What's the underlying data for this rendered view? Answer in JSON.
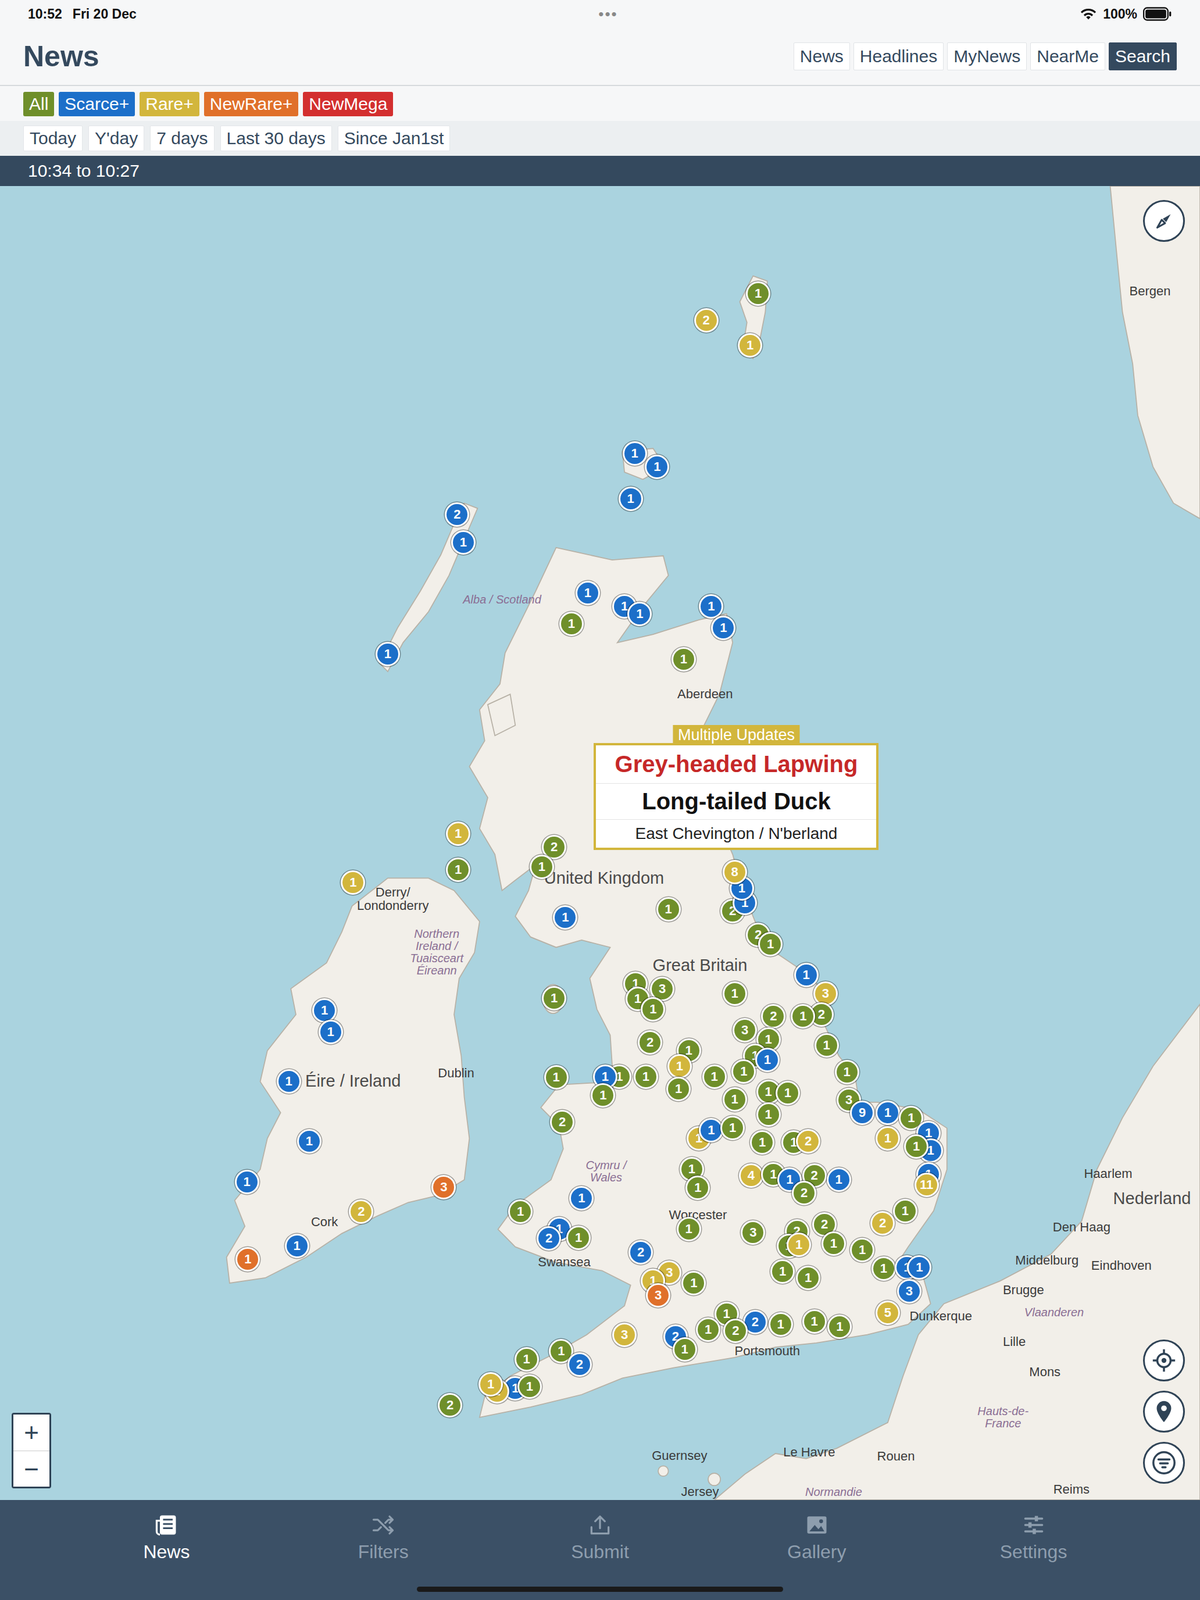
{
  "status_bar": {
    "time": "10:52",
    "date": "Fri 20 Dec",
    "dots": "•••",
    "battery": "100%"
  },
  "header": {
    "title": "News",
    "tabs": [
      {
        "label": "News",
        "selected": false
      },
      {
        "label": "Headlines",
        "selected": false
      },
      {
        "label": "MyNews",
        "selected": false
      },
      {
        "label": "NearMe",
        "selected": false
      },
      {
        "label": "Search",
        "selected": true
      }
    ]
  },
  "filters": [
    {
      "label": "All",
      "color": "#6f8f2a"
    },
    {
      "label": "Scarce+",
      "color": "#1c6fc9"
    },
    {
      "label": "Rare+",
      "color": "#d2b63c"
    },
    {
      "label": "NewRare+",
      "color": "#e0702a"
    },
    {
      "label": "NewMega",
      "color": "#d32f2f"
    }
  ],
  "periods": [
    "Today",
    "Y'day",
    "7 days",
    "Last 30 days",
    "Since Jan1st"
  ],
  "time_range": "10:34 to 10:27",
  "map": {
    "labels": [
      {
        "text": "Bergen",
        "kind": "city"
      },
      {
        "text": "Alba / Scotland",
        "kind": "region"
      },
      {
        "text": "Aberdeen",
        "kind": "city"
      },
      {
        "text": "United Kingdom",
        "kind": "country"
      },
      {
        "text": "Great Britain",
        "kind": "country"
      },
      {
        "text": "Derry/\nLondonderry",
        "kind": "city"
      },
      {
        "text": "Northern\nIreland /\nTuaisceart\nÉireann",
        "kind": "region"
      },
      {
        "text": "Éire / Ireland",
        "kind": "country"
      },
      {
        "text": "Dublin",
        "kind": "city"
      },
      {
        "text": "Cork",
        "kind": "city"
      },
      {
        "text": "Swansea",
        "kind": "city"
      },
      {
        "text": "Cymru /\nWales",
        "kind": "region"
      },
      {
        "text": "Worcester",
        "kind": "city"
      },
      {
        "text": "Portsmouth",
        "kind": "city"
      },
      {
        "text": "Guernsey",
        "kind": "city"
      },
      {
        "text": "Jersey",
        "kind": "city"
      },
      {
        "text": "Le Havre",
        "kind": "city"
      },
      {
        "text": "Rouen",
        "kind": "city"
      },
      {
        "text": "Normandie",
        "kind": "region"
      },
      {
        "text": "Dunkerque",
        "kind": "city"
      },
      {
        "text": "Brugge",
        "kind": "city"
      },
      {
        "text": "Vlaanderen",
        "kind": "region"
      },
      {
        "text": "Middelburg",
        "kind": "city"
      },
      {
        "text": "Den Haag",
        "kind": "city"
      },
      {
        "text": "Haarlem",
        "kind": "city"
      },
      {
        "text": "Nederland",
        "kind": "country"
      },
      {
        "text": "Eindhoven",
        "kind": "city"
      },
      {
        "text": "Lille",
        "kind": "city"
      },
      {
        "text": "Mons",
        "kind": "city"
      },
      {
        "text": "Hauts-de-\nFrance",
        "kind": "region"
      },
      {
        "text": "Reims",
        "kind": "city"
      }
    ],
    "pins": [
      {
        "count": "1",
        "color": "#6f8f2a"
      },
      {
        "count": "2",
        "color": "#d2b63c"
      },
      {
        "count": "1",
        "color": "#d2b63c"
      },
      {
        "count": "1",
        "color": "#1c6fc9"
      },
      {
        "count": "1",
        "color": "#1c6fc9"
      },
      {
        "count": "1",
        "color": "#1c6fc9"
      },
      {
        "count": "2",
        "color": "#1c6fc9"
      },
      {
        "count": "1",
        "color": "#1c6fc9"
      },
      {
        "count": "1",
        "color": "#1c6fc9"
      },
      {
        "count": "1",
        "color": "#1c6fc9"
      },
      {
        "count": "1",
        "color": "#6f8f2a"
      },
      {
        "count": "1",
        "color": "#1c6fc9"
      },
      {
        "count": "1",
        "color": "#1c6fc9"
      },
      {
        "count": "1",
        "color": "#1c6fc9"
      },
      {
        "count": "1",
        "color": "#1c6fc9"
      },
      {
        "count": "1",
        "color": "#6f8f2a"
      },
      {
        "count": "1",
        "color": "#d2b63c"
      },
      {
        "count": "1",
        "color": "#6f8f2a"
      },
      {
        "count": "2",
        "color": "#6f8f2a"
      },
      {
        "count": "1",
        "color": "#6f8f2a"
      },
      {
        "count": "1",
        "color": "#d2b63c"
      },
      {
        "count": "1",
        "color": "#1c6fc9"
      },
      {
        "count": "1",
        "color": "#6f8f2a"
      },
      {
        "count": "2",
        "color": "#6f8f2a"
      },
      {
        "count": "1",
        "color": "#1c6fc9"
      },
      {
        "count": "1",
        "color": "#1c6fc9"
      },
      {
        "count": "8",
        "color": "#d2b63c"
      },
      {
        "count": "2",
        "color": "#6f8f2a"
      },
      {
        "count": "1",
        "color": "#6f8f2a"
      },
      {
        "count": "1",
        "color": "#6f8f2a"
      },
      {
        "count": "1",
        "color": "#6f8f2a"
      },
      {
        "count": "1",
        "color": "#6f8f2a"
      },
      {
        "count": "3",
        "color": "#6f8f2a"
      },
      {
        "count": "1",
        "color": "#6f8f2a"
      },
      {
        "count": "1",
        "color": "#6f8f2a"
      },
      {
        "count": "1",
        "color": "#1c6fc9"
      },
      {
        "count": "3",
        "color": "#d2b63c"
      },
      {
        "count": "2",
        "color": "#6f8f2a"
      },
      {
        "count": "1",
        "color": "#6f8f2a"
      },
      {
        "count": "2",
        "color": "#6f8f2a"
      },
      {
        "count": "3",
        "color": "#6f8f2a"
      },
      {
        "count": "1",
        "color": "#6f8f2a"
      },
      {
        "count": "1",
        "color": "#6f8f2a"
      },
      {
        "count": "2",
        "color": "#6f8f2a"
      },
      {
        "count": "1",
        "color": "#6f8f2a"
      },
      {
        "count": "1",
        "color": "#6f8f2a"
      },
      {
        "count": "1",
        "color": "#6f8f2a"
      },
      {
        "count": "1",
        "color": "#1c6fc9"
      },
      {
        "count": "1",
        "color": "#6f8f2a"
      },
      {
        "count": "1",
        "color": "#6f8f2a"
      },
      {
        "count": "1",
        "color": "#6f8f2a"
      },
      {
        "count": "1",
        "color": "#1c6fc9"
      },
      {
        "count": "1",
        "color": "#d2b63c"
      },
      {
        "count": "1",
        "color": "#6f8f2a"
      },
      {
        "count": "1",
        "color": "#6f8f2a"
      },
      {
        "count": "1",
        "color": "#6f8f2a"
      },
      {
        "count": "1",
        "color": "#6f8f2a"
      },
      {
        "count": "1",
        "color": "#6f8f2a"
      },
      {
        "count": "1",
        "color": "#6f8f2a"
      },
      {
        "count": "1",
        "color": "#6f8f2a"
      },
      {
        "count": "3",
        "color": "#6f8f2a"
      },
      {
        "count": "9",
        "color": "#1c6fc9"
      },
      {
        "count": "1",
        "color": "#1c6fc9"
      },
      {
        "count": "1",
        "color": "#6f8f2a"
      },
      {
        "count": "1",
        "color": "#1c6fc9"
      },
      {
        "count": "1",
        "color": "#1c6fc9"
      },
      {
        "count": "1",
        "color": "#1c6fc9"
      },
      {
        "count": "2",
        "color": "#6f8f2a"
      },
      {
        "count": "1",
        "color": "#d2b63c"
      },
      {
        "count": "1",
        "color": "#1c6fc9"
      },
      {
        "count": "1",
        "color": "#6f8f2a"
      },
      {
        "count": "1",
        "color": "#6f8f2a"
      },
      {
        "count": "1",
        "color": "#6f8f2a"
      },
      {
        "count": "1",
        "color": "#6f8f2a"
      },
      {
        "count": "2",
        "color": "#d2b63c"
      },
      {
        "count": "1",
        "color": "#d2b63c"
      },
      {
        "count": "1",
        "color": "#6f8f2a"
      },
      {
        "count": "1",
        "color": "#6f8f2a"
      },
      {
        "count": "4",
        "color": "#d2b63c"
      },
      {
        "count": "1",
        "color": "#6f8f2a"
      },
      {
        "count": "1",
        "color": "#1c6fc9"
      },
      {
        "count": "2",
        "color": "#6f8f2a"
      },
      {
        "count": "1",
        "color": "#1c6fc9"
      },
      {
        "count": "2",
        "color": "#6f8f2a"
      },
      {
        "count": "1",
        "color": "#6f8f2a"
      },
      {
        "count": "11",
        "color": "#d2b63c"
      },
      {
        "count": "1",
        "color": "#1c6fc9"
      },
      {
        "count": "1",
        "color": "#6f8f2a"
      },
      {
        "count": "3",
        "color": "#6f8f2a"
      },
      {
        "count": "2",
        "color": "#6f8f2a"
      },
      {
        "count": "2",
        "color": "#6f8f2a"
      },
      {
        "count": "1",
        "color": "#6f8f2a"
      },
      {
        "count": "2",
        "color": "#d2b63c"
      },
      {
        "count": "1",
        "color": "#1c6fc9"
      },
      {
        "count": "2",
        "color": "#1c6fc9"
      },
      {
        "count": "1",
        "color": "#6f8f2a"
      },
      {
        "count": "1",
        "color": "#6f8f2a"
      },
      {
        "count": "1",
        "color": "#6f8f2a"
      },
      {
        "count": "1",
        "color": "#d2b63c"
      },
      {
        "count": "1",
        "color": "#6f8f2a"
      },
      {
        "count": "1",
        "color": "#6f8f2a"
      },
      {
        "count": "2",
        "color": "#1c6fc9"
      },
      {
        "count": "3",
        "color": "#d2b63c"
      },
      {
        "count": "1",
        "color": "#d2b63c"
      },
      {
        "count": "1",
        "color": "#6f8f2a"
      },
      {
        "count": "3",
        "color": "#e0702a"
      },
      {
        "count": "1",
        "color": "#6f8f2a"
      },
      {
        "count": "1",
        "color": "#6f8f2a"
      },
      {
        "count": "1",
        "color": "#6f8f2a"
      },
      {
        "count": "1",
        "color": "#1c6fc9"
      },
      {
        "count": "1",
        "color": "#1c6fc9"
      },
      {
        "count": "3",
        "color": "#1c6fc9"
      },
      {
        "count": "5",
        "color": "#d2b63c"
      },
      {
        "count": "1",
        "color": "#6f8f2a"
      },
      {
        "count": "2",
        "color": "#1c6fc9"
      },
      {
        "count": "1",
        "color": "#6f8f2a"
      },
      {
        "count": "1",
        "color": "#6f8f2a"
      },
      {
        "count": "1",
        "color": "#6f8f2a"
      },
      {
        "count": "1",
        "color": "#6f8f2a"
      },
      {
        "count": "2",
        "color": "#6f8f2a"
      },
      {
        "count": "2",
        "color": "#1c6fc9"
      },
      {
        "count": "3",
        "color": "#d2b63c"
      },
      {
        "count": "1",
        "color": "#6f8f2a"
      },
      {
        "count": "1",
        "color": "#6f8f2a"
      },
      {
        "count": "2",
        "color": "#1c6fc9"
      },
      {
        "count": "1",
        "color": "#6f8f2a"
      },
      {
        "count": "1",
        "color": "#1c6fc9"
      },
      {
        "count": "1",
        "color": "#6f8f2a"
      },
      {
        "count": "1",
        "color": "#d2b63c"
      },
      {
        "count": "1",
        "color": "#d2b63c"
      },
      {
        "count": "2",
        "color": "#6f8f2a"
      },
      {
        "count": "1",
        "color": "#1c6fc9"
      },
      {
        "count": "1",
        "color": "#1c6fc9"
      },
      {
        "count": "1",
        "color": "#1c6fc9"
      },
      {
        "count": "1",
        "color": "#1c6fc9"
      },
      {
        "count": "1",
        "color": "#1c6fc9"
      },
      {
        "count": "1",
        "color": "#1c6fc9"
      },
      {
        "count": "1",
        "color": "#e0702a"
      },
      {
        "count": "2",
        "color": "#d2b63c"
      },
      {
        "count": "3",
        "color": "#e0702a"
      }
    ],
    "popup": {
      "tag": "Multiple Updates",
      "title": "Grey-headed Lapwing",
      "title_color": "#c62828",
      "subtitle": "Long-tailed Duck",
      "location": "East Chevington / N'berland"
    },
    "zoom": {
      "in": "+",
      "out": "−"
    }
  },
  "nav": [
    {
      "label": "News",
      "selected": true
    },
    {
      "label": "Filters",
      "selected": false
    },
    {
      "label": "Submit",
      "selected": false
    },
    {
      "label": "Gallery",
      "selected": false
    },
    {
      "label": "Settings",
      "selected": false
    }
  ]
}
